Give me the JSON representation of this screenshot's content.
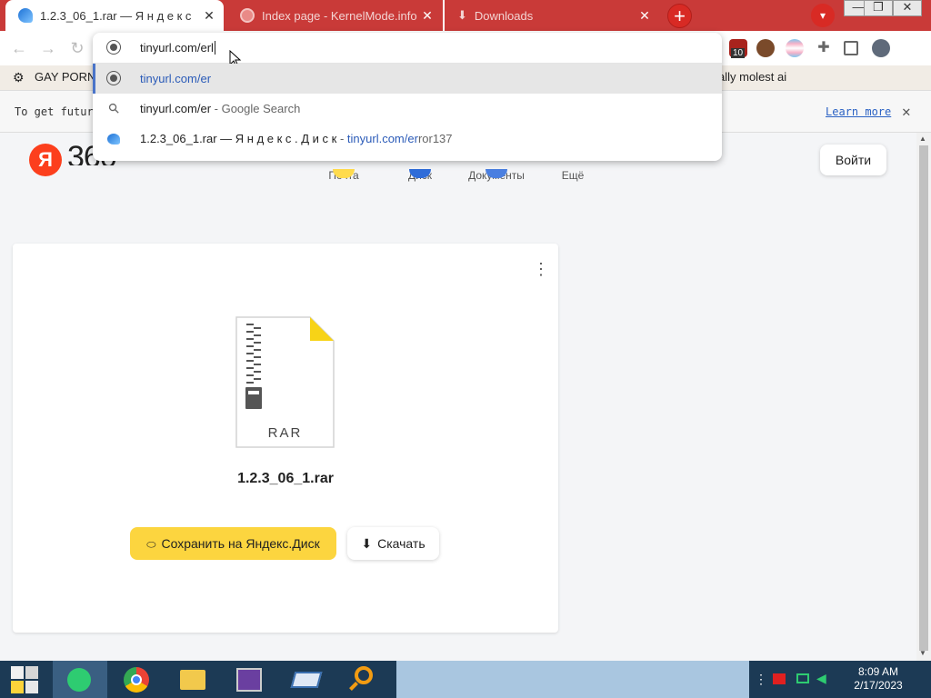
{
  "browser": {
    "tabs": [
      {
        "title": "1.2.3_06_1.rar — Я н д е к с",
        "active": true,
        "icon": "yandex-disk-icon"
      },
      {
        "title": "Index page - KernelMode.info",
        "active": false,
        "icon": "globe-icon"
      },
      {
        "title": "Downloads",
        "active": false,
        "icon": "download-icon"
      }
    ],
    "new_tab_label": "+",
    "tab_search_label": "▾",
    "window_controls": {
      "minimize": "—",
      "maximize": "❐",
      "close": "✕"
    },
    "extension_badge": "10"
  },
  "omnibox": {
    "typed_text": "tinyurl.com/erl",
    "suggestions": [
      {
        "icon": "globe-icon",
        "parts": [
          {
            "text": "tinyurl.com/er",
            "style": "blue"
          }
        ]
      },
      {
        "icon": "search-icon",
        "parts": [
          {
            "text": "tinyurl.com/er",
            "style": "plain"
          },
          {
            "text": " - Google Search",
            "style": "grey"
          }
        ]
      },
      {
        "icon": "yandex-disk-icon",
        "parts": [
          {
            "text": "1.2.3_06_1.rar — Я н д е к с . Д и с к",
            "style": "plain"
          },
          {
            "text": " - ",
            "style": "grey"
          },
          {
            "text": "tinyurl.com/er",
            "style": "blue"
          },
          {
            "text": "ror137",
            "style": "grey"
          }
        ]
      }
    ]
  },
  "bookmarks": {
    "left_label": "GAY PORN",
    "right_label": "ally molest ai"
  },
  "infobar": {
    "text": "To get future (",
    "learn_more": "Learn more",
    "close": "✕"
  },
  "page": {
    "logo_letter": "Я",
    "logo_text": "360",
    "services": [
      "Почта",
      "Диск",
      "Документы",
      "Ещё"
    ],
    "login_label": "Войти",
    "file": {
      "type_label": "RAR",
      "name": "1.2.3_06_1.rar"
    },
    "save_button": "Сохранить на Яндекс.Диск",
    "download_button": "Скачать",
    "menu_icon": "⋮"
  },
  "taskbar": {
    "apps": [
      "windows-start-icon",
      "notes-app-icon",
      "chrome-icon",
      "file-explorer-icon",
      "cpu-z-icon",
      "virtual-drive-icon",
      "search-magnifier-icon"
    ],
    "time": "8:09 AM",
    "date": "2/17/2023"
  },
  "colors": {
    "tabstrip": "#c93a38",
    "yandex_red": "#fc3f1d",
    "save_yellow": "#fcd53f",
    "link_blue": "#2b5bb8",
    "taskbar": "#1c3a55"
  }
}
